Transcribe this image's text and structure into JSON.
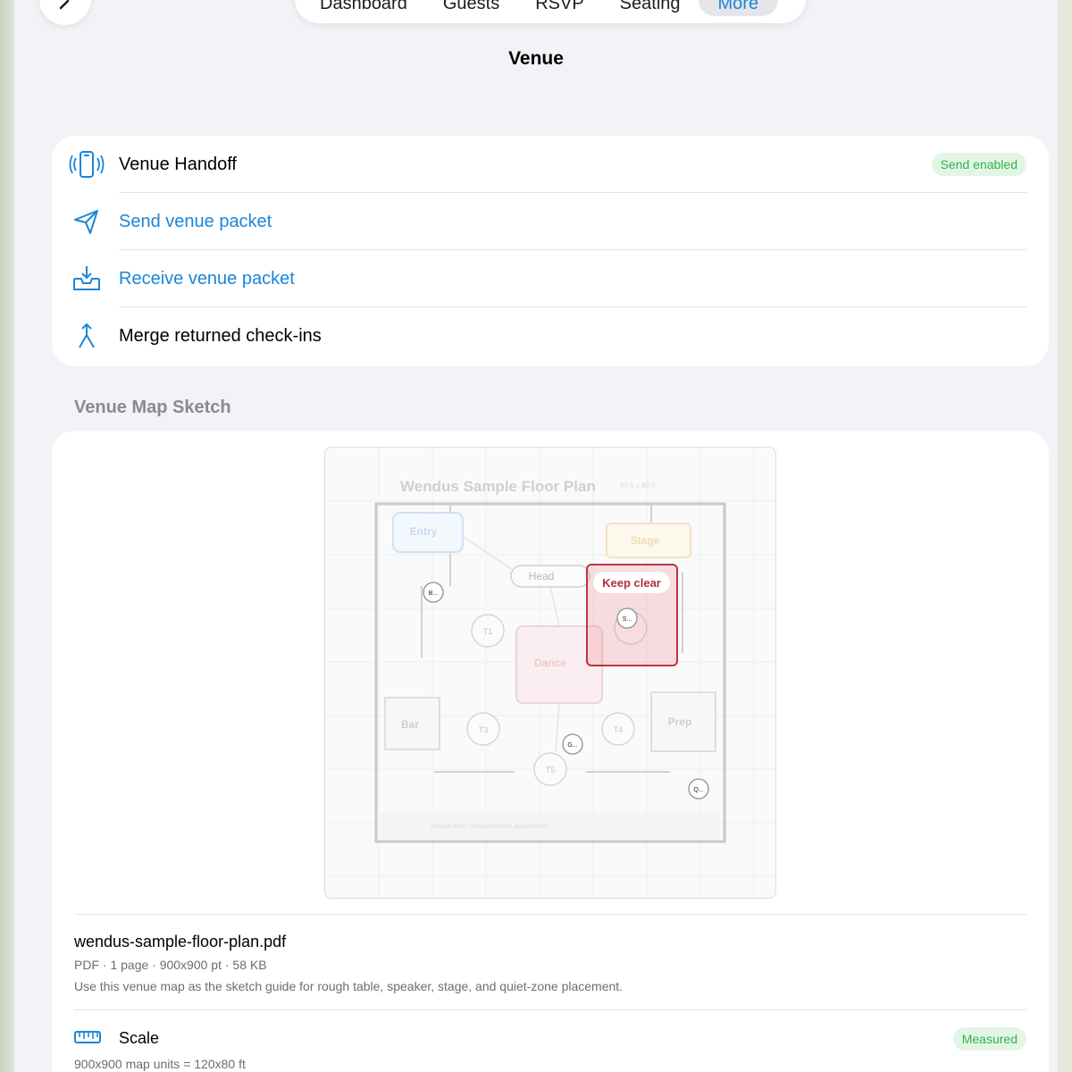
{
  "nav": {
    "tabs": [
      "Dashboard",
      "Guests",
      "RSVP",
      "Seating",
      "More"
    ],
    "active_tab": "More"
  },
  "page": {
    "title": "Venue"
  },
  "handoff": {
    "title": "Venue Handoff",
    "status_badge": "Send enabled",
    "send_label": "Send venue packet",
    "receive_label": "Receive venue packet",
    "merge_label": "Merge returned check-ins"
  },
  "map_section": {
    "title": "Venue Map Sketch",
    "plan": {
      "title": "Wendus Sample Floor Plan",
      "dimensions": "80 ft x 80 ft",
      "footer_note": "Sample plan - measurements approximate",
      "zones": {
        "entry": "Entry",
        "stage": "Stage",
        "head": "Head",
        "dance": "Dance",
        "bar": "Bar",
        "prep": "Prep",
        "keep_clear": "Keep clear"
      },
      "tables": [
        "T1",
        "T3",
        "T4",
        "T5"
      ],
      "markers": [
        "B...",
        "S...",
        "G...",
        "Q..."
      ]
    },
    "file": {
      "name": "wendus-sample-floor-plan.pdf",
      "meta": "PDF · 1 page · 900x900 pt · 58 KB",
      "description": "Use this venue map as the sketch guide for rough table, speaker, stage, and quiet-zone placement."
    },
    "scale": {
      "label": "Scale",
      "badge": "Measured",
      "detail": "900x900 map units = 120x80 ft"
    }
  },
  "colors": {
    "accent": "#1a86d9",
    "success_bg": "#e3f6e6",
    "success_text": "#34b24a",
    "keep_clear": "#c0343f"
  },
  "icons": [
    "chevron-left-icon",
    "phone-broadcast-icon",
    "paper-plane-icon",
    "inbox-download-icon",
    "merge-arrow-icon",
    "ruler-icon"
  ]
}
